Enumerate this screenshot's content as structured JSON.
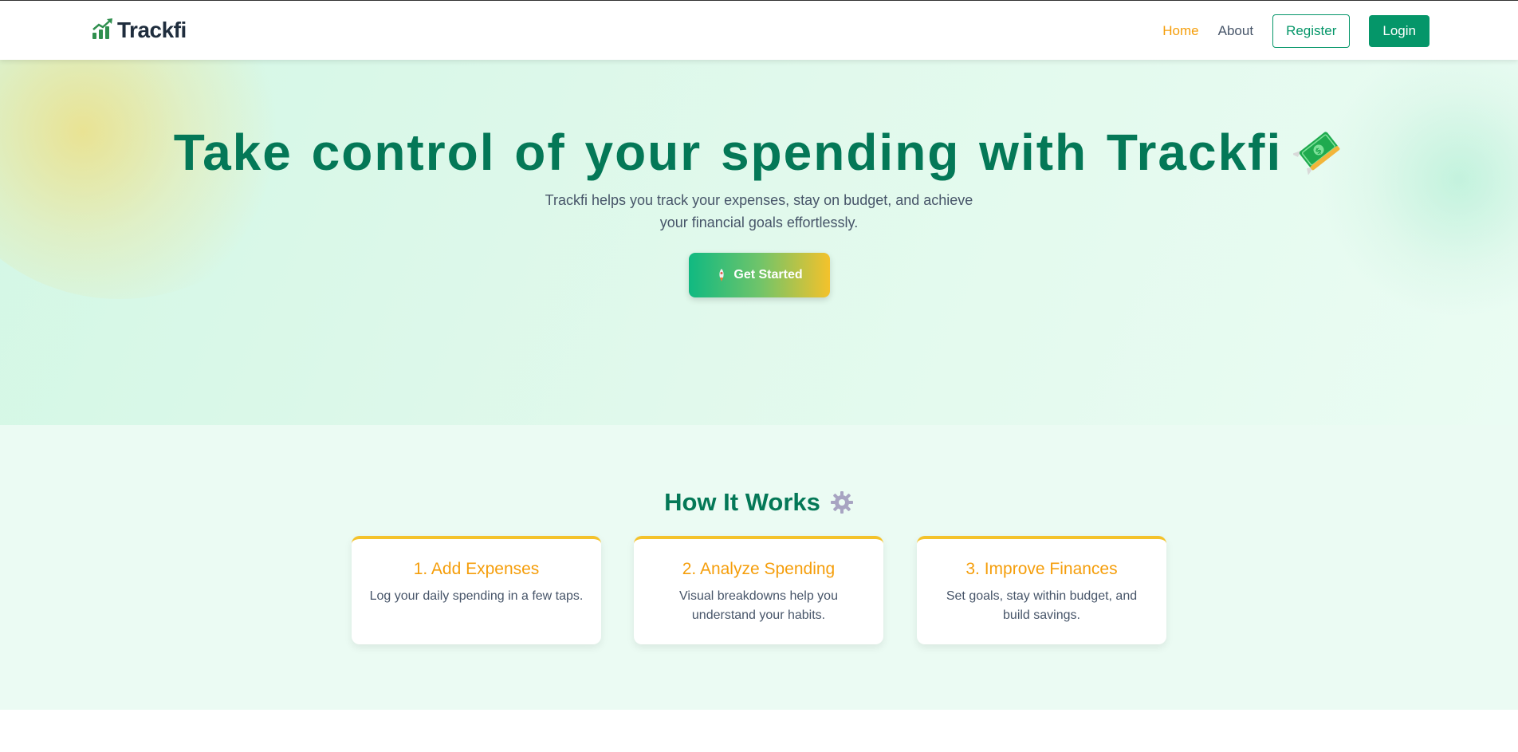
{
  "header": {
    "logo_text": "Trackfi",
    "nav": {
      "home": "Home",
      "about": "About",
      "register": "Register",
      "login": "Login"
    }
  },
  "hero": {
    "title": "Take control of your spending with Trackfi",
    "title_icon": "money-with-wings-icon",
    "subtitle": "Trackfi helps you track your expenses, stay on budget, and achieve your financial goals effortlessly.",
    "cta_label": "Get Started",
    "cta_icon": "rocket-icon"
  },
  "how_it_works": {
    "title": "How It Works",
    "title_icon": "gear-icon",
    "cards": [
      {
        "title": "1. Add Expenses",
        "text": "Log your daily spending in a few taps."
      },
      {
        "title": "2. Analyze Spending",
        "text": "Visual breakdowns help you understand your habits."
      },
      {
        "title": "3. Improve Finances",
        "text": "Set goals, stay within budget, and build savings."
      }
    ]
  },
  "colors": {
    "brand_green": "#047857",
    "button_green": "#059669",
    "accent_orange": "#f59e0b",
    "accent_yellow": "#f4c22b"
  }
}
